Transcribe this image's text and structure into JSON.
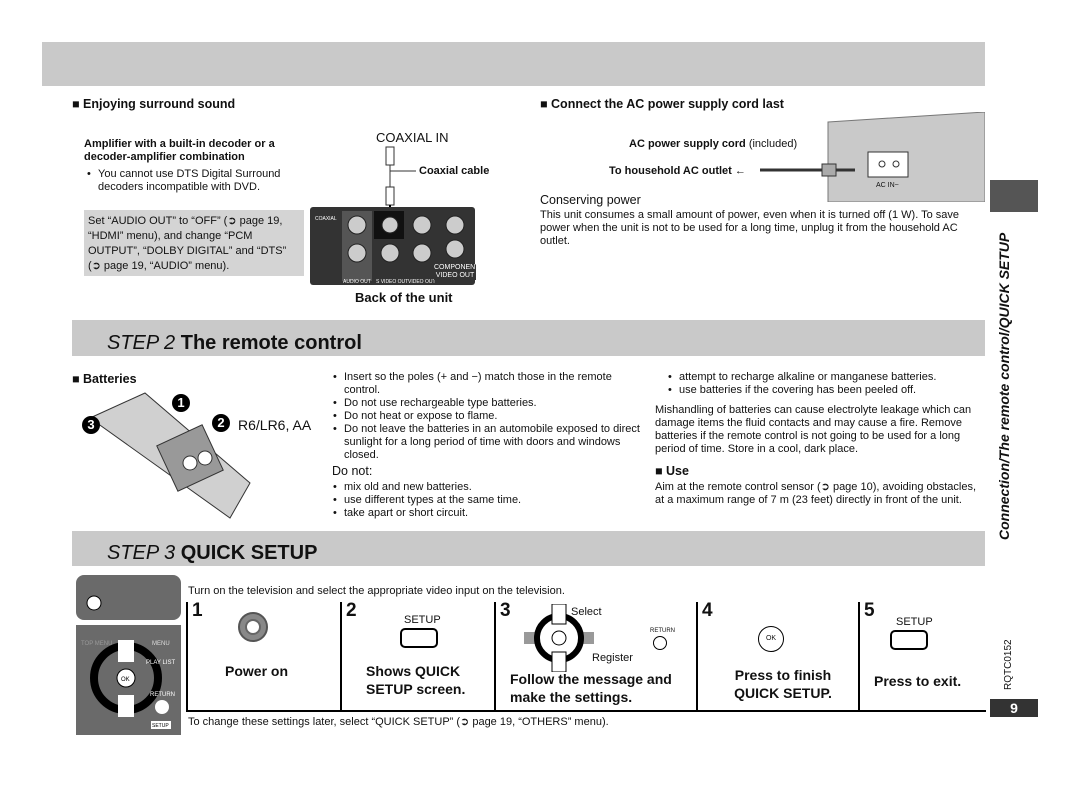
{
  "surround": {
    "heading": "Enjoying surround sound",
    "amp_title": "Amplifier with a built-in decoder or a decoder-amplifier combination",
    "amp_note": "You cannot use DTS Digital Surround decoders incompatible with DVD.",
    "setting_note": "Set “AUDIO OUT” to “OFF” (➲ page 19, “HDMI” menu), and change “PCM OUTPUT”, “DOLBY DIGITAL” and “DTS” (➲ page 19, “AUDIO” menu).",
    "coaxial_in": "COAXIAL IN",
    "coaxial_cable": "Coaxial cable",
    "back_label": "Back of the unit",
    "panel_labels": [
      "COAXIAL",
      "AUDIO OUT",
      "S VIDEO OUT",
      "VIDEO OUT",
      "COMPONENT VIDEO OUT"
    ]
  },
  "ac": {
    "heading": "Connect the AC power supply cord last",
    "cord_label_bold": "AC power supply cord",
    "cord_label_note": "(included)",
    "outlet_label": "To household AC outlet",
    "ac_in": "AC IN~",
    "conserving_title": "Conserving power",
    "conserving_text": "This unit consumes a small amount of power, even when it is turned off (1 W). To save power when the unit is not to be used for a long time, unplug it from the household AC outlet."
  },
  "step2": {
    "step": "STEP 2",
    "title": "The remote control",
    "batteries_heading": "Batteries",
    "battery_type": "R6/LR6, AA",
    "markers": [
      "1",
      "2",
      "3"
    ],
    "bullets": [
      "Insert so the poles (+ and −) match those in the remote control.",
      "Do not use rechargeable type batteries.",
      "Do not heat or expose to flame.",
      "Do not leave the batteries in an automobile exposed to direct sunlight for a long period of time with doors and windows closed."
    ],
    "do_not_title": "Do not:",
    "do_not": [
      "mix old and new batteries.",
      "use different types at the same time.",
      "take apart or short circuit.",
      "attempt to recharge alkaline or manganese batteries.",
      "use batteries if the covering has been peeled off."
    ],
    "mishandling": "Mishandling of batteries can cause electrolyte leakage which can damage items the fluid contacts and may cause a fire. Remove batteries if the remote control is not going to be used for a long period of time. Store in a cool, dark place.",
    "use_heading": "Use",
    "use_text": "Aim at the remote control sensor (➲ page 10), avoiding obstacles, at a maximum range of 7 m (23 feet) directly in front of the unit."
  },
  "step3": {
    "step": "STEP 3",
    "title": "QUICK SETUP",
    "intro": "Turn on the television and select the appropriate video input on the television.",
    "steps": [
      {
        "num": "1",
        "caption": "Power on"
      },
      {
        "num": "2",
        "button": "SETUP",
        "caption": "Shows QUICK SETUP screen."
      },
      {
        "num": "3",
        "select": "Select",
        "register": "Register",
        "ok": "OK",
        "return": "RETURN",
        "caption": "Follow the message and make the settings."
      },
      {
        "num": "4",
        "ok": "OK",
        "caption": "Press to finish QUICK SETUP."
      },
      {
        "num": "5",
        "button": "SETUP",
        "caption": "Press to exit."
      }
    ],
    "footer": "To change these settings later, select “QUICK SETUP” (➲ page 19, “OTHERS” menu).",
    "remote_labels": {
      "ok": "OK",
      "menu": "MENU",
      "play_list": "PLAY LIST",
      "return": "RETURN",
      "setup": "SETUP",
      "top_menu": "TOP MENU"
    }
  },
  "side": {
    "section": "Connection/The remote control/QUICK SETUP",
    "code": "RQTC0152",
    "page": "9"
  }
}
